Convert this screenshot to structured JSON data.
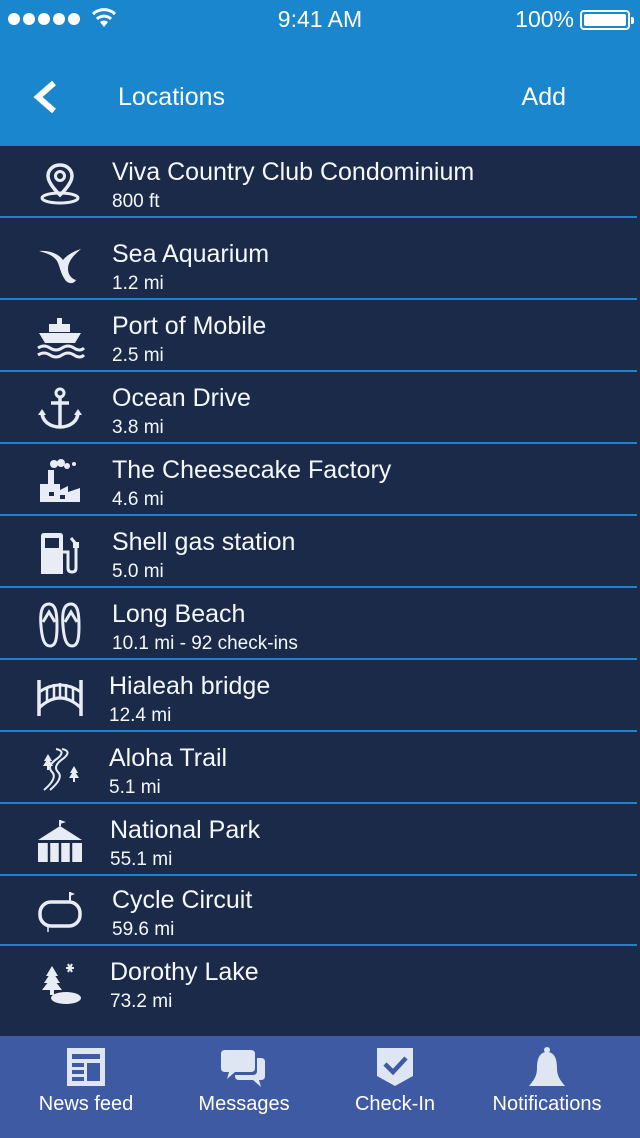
{
  "status_bar": {
    "time": "9:41 AM",
    "battery": "100%"
  },
  "nav": {
    "title": "Locations",
    "add_label": "Add"
  },
  "locations": [
    {
      "name": "Viva Country Club Condominium",
      "distance": "800 ft",
      "icon": "map-pin-icon"
    },
    {
      "name": "Sea Aquarium",
      "distance": "1.2 mi",
      "icon": "whale-tail-icon"
    },
    {
      "name": "Port of Mobile",
      "distance": "2.5 mi",
      "icon": "ship-icon"
    },
    {
      "name": "Ocean Drive",
      "distance": "3.8 mi",
      "icon": "anchor-icon"
    },
    {
      "name": "The Cheesecake Factory",
      "distance": "4.6 mi",
      "icon": "factory-icon"
    },
    {
      "name": "Shell gas station",
      "distance": "5.0 mi",
      "icon": "gas-pump-icon"
    },
    {
      "name": "Long Beach",
      "distance": "10.1 mi - 92 check-ins",
      "icon": "flip-flops-icon"
    },
    {
      "name": "Hialeah bridge",
      "distance": "12.4 mi",
      "icon": "bridge-icon"
    },
    {
      "name": "Aloha Trail",
      "distance": "5.1 mi",
      "icon": "trail-icon"
    },
    {
      "name": "National Park",
      "distance": "55.1 mi",
      "icon": "tent-icon"
    },
    {
      "name": "Cycle Circuit",
      "distance": "59.6 mi",
      "icon": "circuit-icon"
    },
    {
      "name": "Dorothy Lake",
      "distance": "73.2 mi",
      "icon": "lake-icon"
    }
  ],
  "tabs": [
    {
      "label": "News feed",
      "icon": "newspaper-icon"
    },
    {
      "label": "Messages",
      "icon": "chat-bubbles-icon"
    },
    {
      "label": "Check-In",
      "icon": "check-badge-icon"
    },
    {
      "label": "Notifications",
      "icon": "bell-icon"
    }
  ],
  "colors": {
    "header": "#1a86cd",
    "list_bg": "#1b2a48",
    "separator": "#1e84c9",
    "tab_bar": "#3d5aa3"
  }
}
